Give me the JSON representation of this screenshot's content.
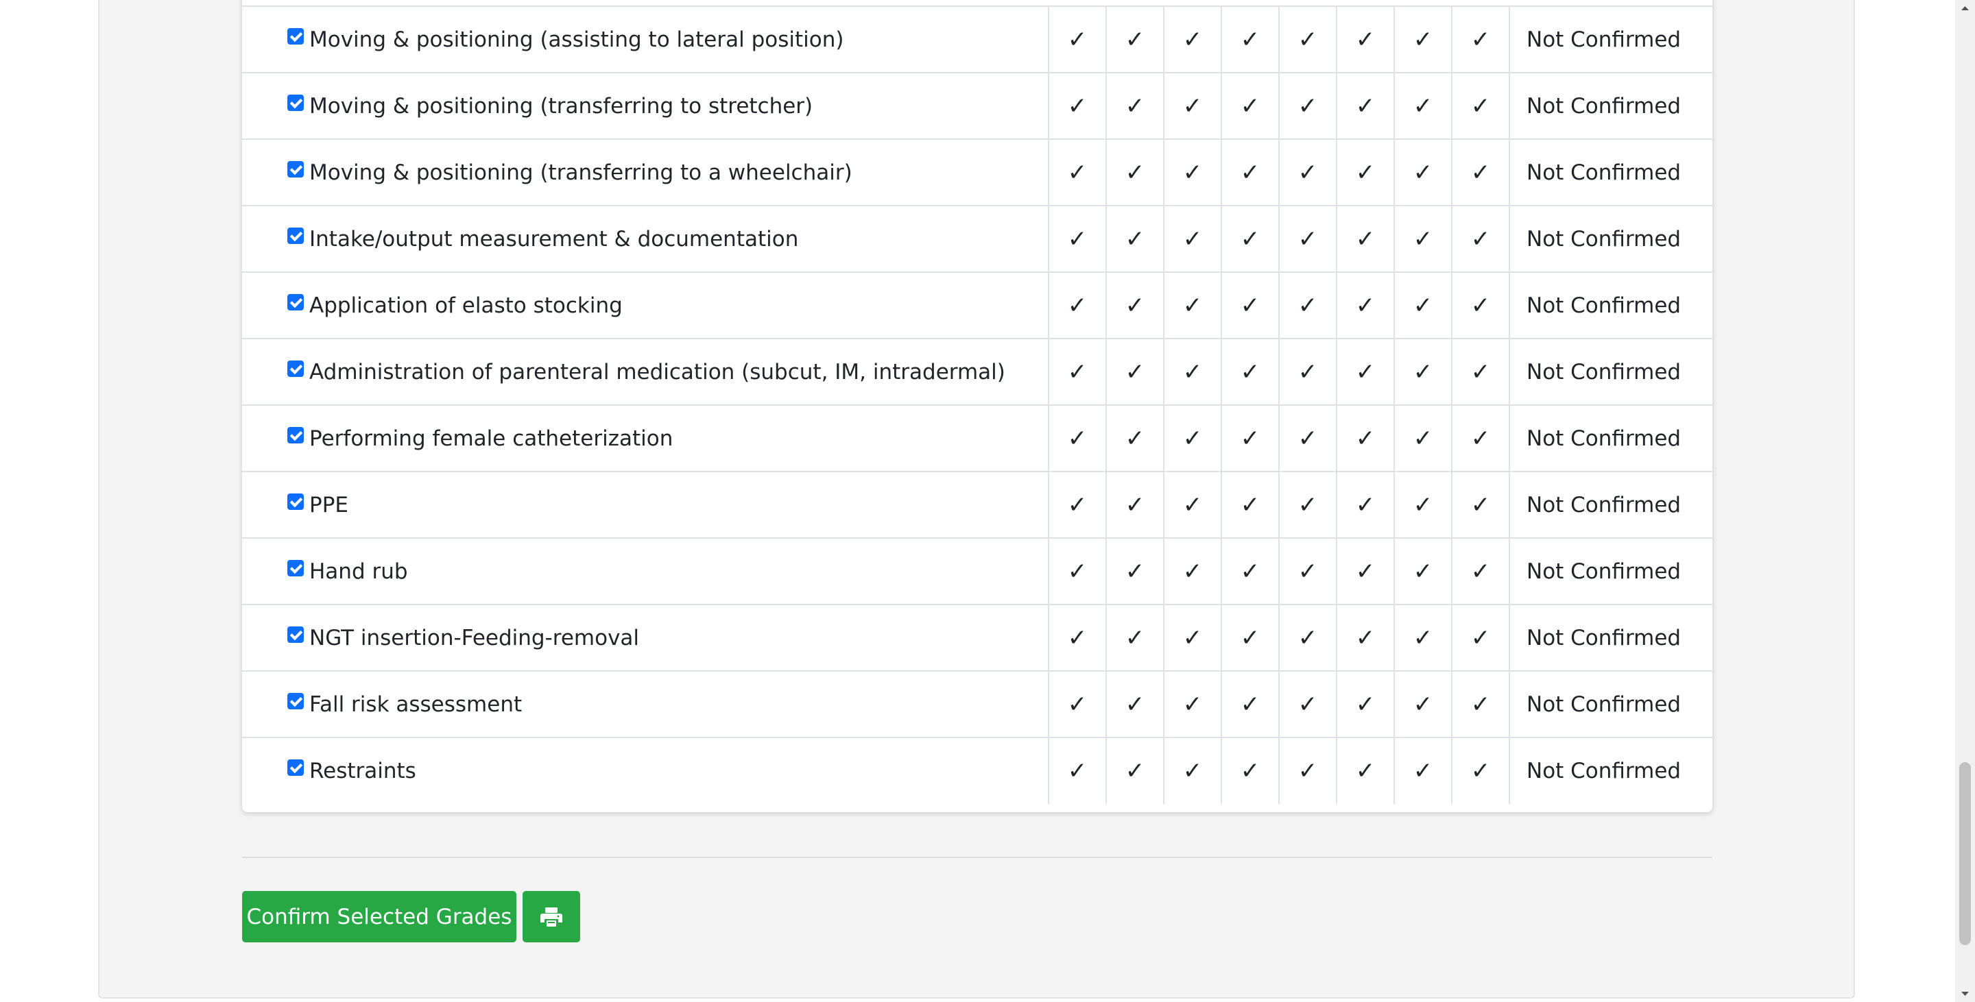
{
  "rows": [
    {
      "skill": "Moving & positioning (assisting to lateral position)",
      "marks": [
        "✓",
        "✓",
        "✓",
        "✓",
        "✓",
        "✓",
        "✓",
        "✓"
      ],
      "status": "Not Confirmed",
      "checked": true
    },
    {
      "skill": "Moving & positioning (transferring to stretcher)",
      "marks": [
        "✓",
        "✓",
        "✓",
        "✓",
        "✓",
        "✓",
        "✓",
        "✓"
      ],
      "status": "Not Confirmed",
      "checked": true
    },
    {
      "skill": "Moving & positioning (transferring to a wheelchair)",
      "marks": [
        "✓",
        "✓",
        "✓",
        "✓",
        "✓",
        "✓",
        "✓",
        "✓"
      ],
      "status": "Not Confirmed",
      "checked": true
    },
    {
      "skill": "Intake/output measurement & documentation",
      "marks": [
        "✓",
        "✓",
        "✓",
        "✓",
        "✓",
        "✓",
        "✓",
        "✓"
      ],
      "status": "Not Confirmed",
      "checked": true
    },
    {
      "skill": "Application of elasto stocking",
      "marks": [
        "✓",
        "✓",
        "✓",
        "✓",
        "✓",
        "✓",
        "✓",
        "✓"
      ],
      "status": "Not Confirmed",
      "checked": true
    },
    {
      "skill": "Administration of parenteral medication (subcut, IM, intradermal)",
      "marks": [
        "✓",
        "✓",
        "✓",
        "✓",
        "✓",
        "✓",
        "✓",
        "✓"
      ],
      "status": "Not Confirmed",
      "checked": true
    },
    {
      "skill": "Performing female catheterization",
      "marks": [
        "✓",
        "✓",
        "✓",
        "✓",
        "✓",
        "✓",
        "✓",
        "✓"
      ],
      "status": "Not Confirmed",
      "checked": true
    },
    {
      "skill": "PPE",
      "marks": [
        "✓",
        "✓",
        "✓",
        "✓",
        "✓",
        "✓",
        "✓",
        "✓"
      ],
      "status": "Not Confirmed",
      "checked": true
    },
    {
      "skill": "Hand rub",
      "marks": [
        "✓",
        "✓",
        "✓",
        "✓",
        "✓",
        "✓",
        "✓",
        "✓"
      ],
      "status": "Not Confirmed",
      "checked": true
    },
    {
      "skill": "NGT insertion-Feeding-removal",
      "marks": [
        "✓",
        "✓",
        "✓",
        "✓",
        "✓",
        "✓",
        "✓",
        "✓"
      ],
      "status": "Not Confirmed",
      "checked": true
    },
    {
      "skill": "Fall risk assessment",
      "marks": [
        "✓",
        "✓",
        "✓",
        "✓",
        "✓",
        "✓",
        "✓",
        "✓"
      ],
      "status": "Not Confirmed",
      "checked": true
    },
    {
      "skill": "Restraints",
      "marks": [
        "✓",
        "✓",
        "✓",
        "✓",
        "✓",
        "✓",
        "✓",
        "✓"
      ],
      "status": "Not Confirmed",
      "checked": true
    }
  ],
  "actions": {
    "confirm_label": "Confirm Selected Grades",
    "print_icon": "print-icon"
  },
  "colors": {
    "button_green": "#28a745",
    "checkbox_blue": "#0d6efd",
    "panel_bg": "#f4f4f4"
  }
}
